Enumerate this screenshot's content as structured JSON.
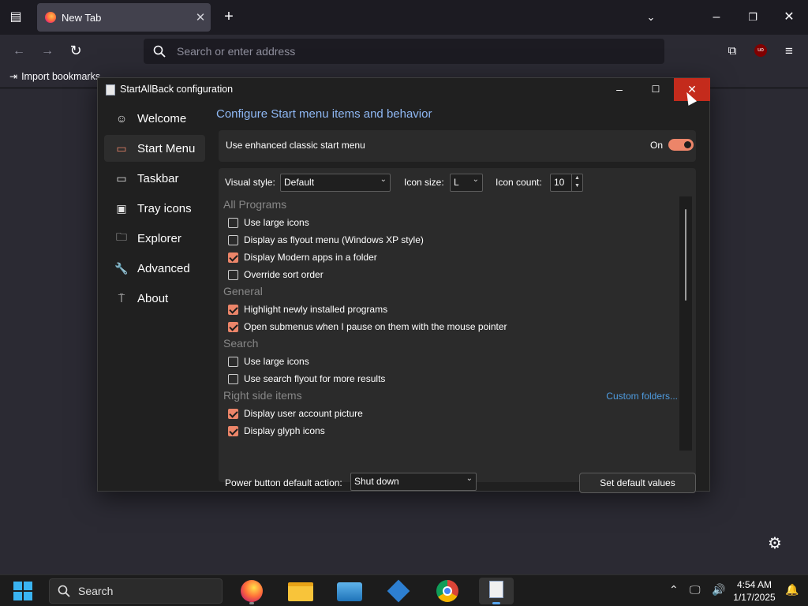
{
  "browser": {
    "tab_title": "New Tab",
    "url_placeholder": "Search or enter address",
    "bookmark_item": "Import bookmarks..."
  },
  "dialog": {
    "title": "StartAllBack configuration",
    "sidebar": {
      "items": [
        {
          "label": "Welcome",
          "icon": "smile-icon",
          "glyph": "☺"
        },
        {
          "label": "Start Menu",
          "icon": "start-menu-icon",
          "glyph": "▭"
        },
        {
          "label": "Taskbar",
          "icon": "taskbar-icon",
          "glyph": "▭"
        },
        {
          "label": "Tray icons",
          "icon": "tray-icon",
          "glyph": "▣"
        },
        {
          "label": "Explorer",
          "icon": "folder-icon",
          "glyph": "🗀"
        },
        {
          "label": "Advanced",
          "icon": "wrench-icon",
          "glyph": "🔧"
        },
        {
          "label": "About",
          "icon": "about-icon",
          "glyph": "⍑"
        }
      ],
      "active": "Start Menu"
    },
    "heading": "Configure Start menu items and behavior",
    "enhanced": {
      "label": "Use enhanced classic start menu",
      "state": "On"
    },
    "visual_style": {
      "label": "Visual style:",
      "value": "Default"
    },
    "icon_size": {
      "label": "Icon size:",
      "value": "L"
    },
    "icon_count": {
      "label": "Icon count:",
      "value": "10"
    },
    "sections": {
      "all_programs": "All Programs",
      "general": "General",
      "search": "Search",
      "right_side": "Right side items"
    },
    "options": {
      "ap_large": {
        "label": "Use large icons",
        "checked": false
      },
      "ap_flyout": {
        "label": "Display as flyout menu (Windows XP style)",
        "checked": false
      },
      "ap_modern": {
        "label": "Display Modern apps in a folder",
        "checked": true
      },
      "ap_sort": {
        "label": "Override sort order",
        "checked": false
      },
      "gen_highlight": {
        "label": "Highlight newly installed programs",
        "checked": true
      },
      "gen_submenus": {
        "label": "Open submenus when I pause on them with the mouse pointer",
        "checked": true
      },
      "srch_large": {
        "label": "Use large icons",
        "checked": false
      },
      "srch_flyout": {
        "label": "Use search flyout for more results",
        "checked": false
      },
      "rs_account": {
        "label": "Display user account picture",
        "checked": true
      },
      "rs_glyph": {
        "label": "Display glyph icons",
        "checked": true
      }
    },
    "custom_folders": "Custom folders...",
    "power_button": {
      "label": "Power button default action:",
      "value": "Shut down"
    },
    "set_default": "Set default values"
  },
  "taskbar": {
    "search_label": "Search",
    "time": "4:54 AM",
    "date": "1/17/2025"
  },
  "colors": {
    "accent": "#ec8569",
    "heading": "#8fb8f4",
    "link": "#4f9ce0",
    "close": "#c42b1c"
  }
}
